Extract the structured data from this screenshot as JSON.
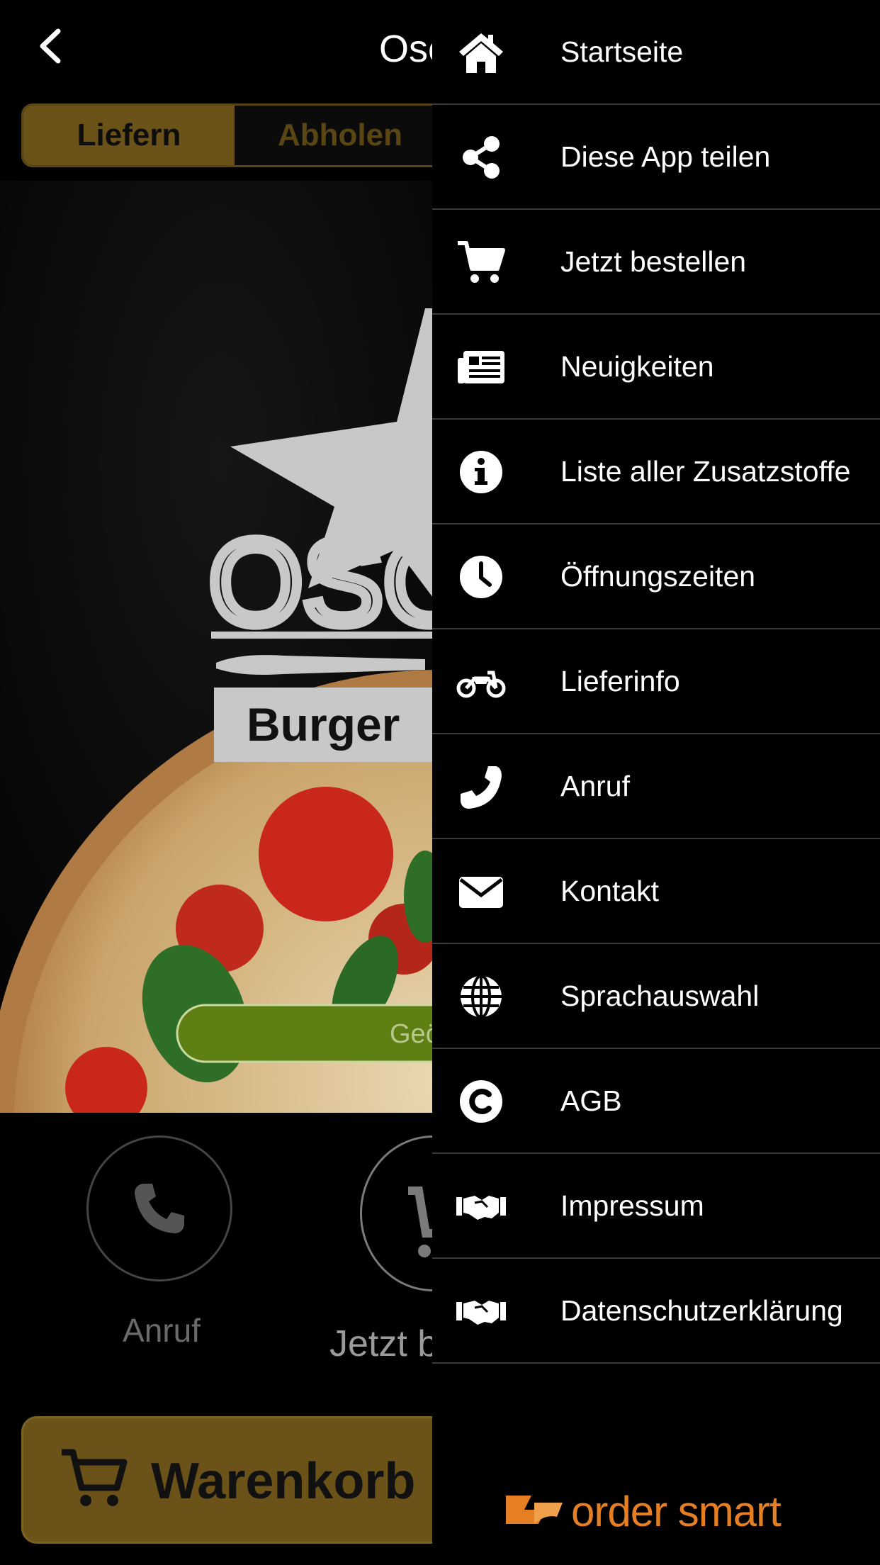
{
  "header": {
    "title": "Osc"
  },
  "segment": {
    "deliver": "Liefern",
    "pickup": "Abholen"
  },
  "hero": {
    "logo_text": "OSC",
    "logo_sub": "Burger",
    "open_badge": "Geö"
  },
  "quick_actions": {
    "call": "Anruf",
    "order": "Jetzt b"
  },
  "cart": {
    "label": "Warenkorb"
  },
  "drawer": {
    "items": [
      {
        "label": "Startseite",
        "icon": "home-icon"
      },
      {
        "label": "Diese App teilen",
        "icon": "share-icon"
      },
      {
        "label": "Jetzt bestellen",
        "icon": "cart-icon"
      },
      {
        "label": "Neuigkeiten",
        "icon": "newspaper-icon"
      },
      {
        "label": "Liste aller Zusatzstoffe",
        "icon": "info-icon"
      },
      {
        "label": "Öffnungszeiten",
        "icon": "clock-icon"
      },
      {
        "label": "Lieferinfo",
        "icon": "motorcycle-icon"
      },
      {
        "label": "Anruf",
        "icon": "phone-icon"
      },
      {
        "label": "Kontakt",
        "icon": "envelope-icon"
      },
      {
        "label": "Sprachauswahl",
        "icon": "globe-icon"
      },
      {
        "label": "AGB",
        "icon": "copyright-icon"
      },
      {
        "label": "Impressum",
        "icon": "handshake-icon"
      },
      {
        "label": "Datenschutzerklärung",
        "icon": "handshake-icon"
      }
    ],
    "brand": "order smart"
  },
  "colors": {
    "accent_gold": "#6b5218",
    "open_green": "#5e7f14",
    "brand_orange": "#e67e22"
  }
}
